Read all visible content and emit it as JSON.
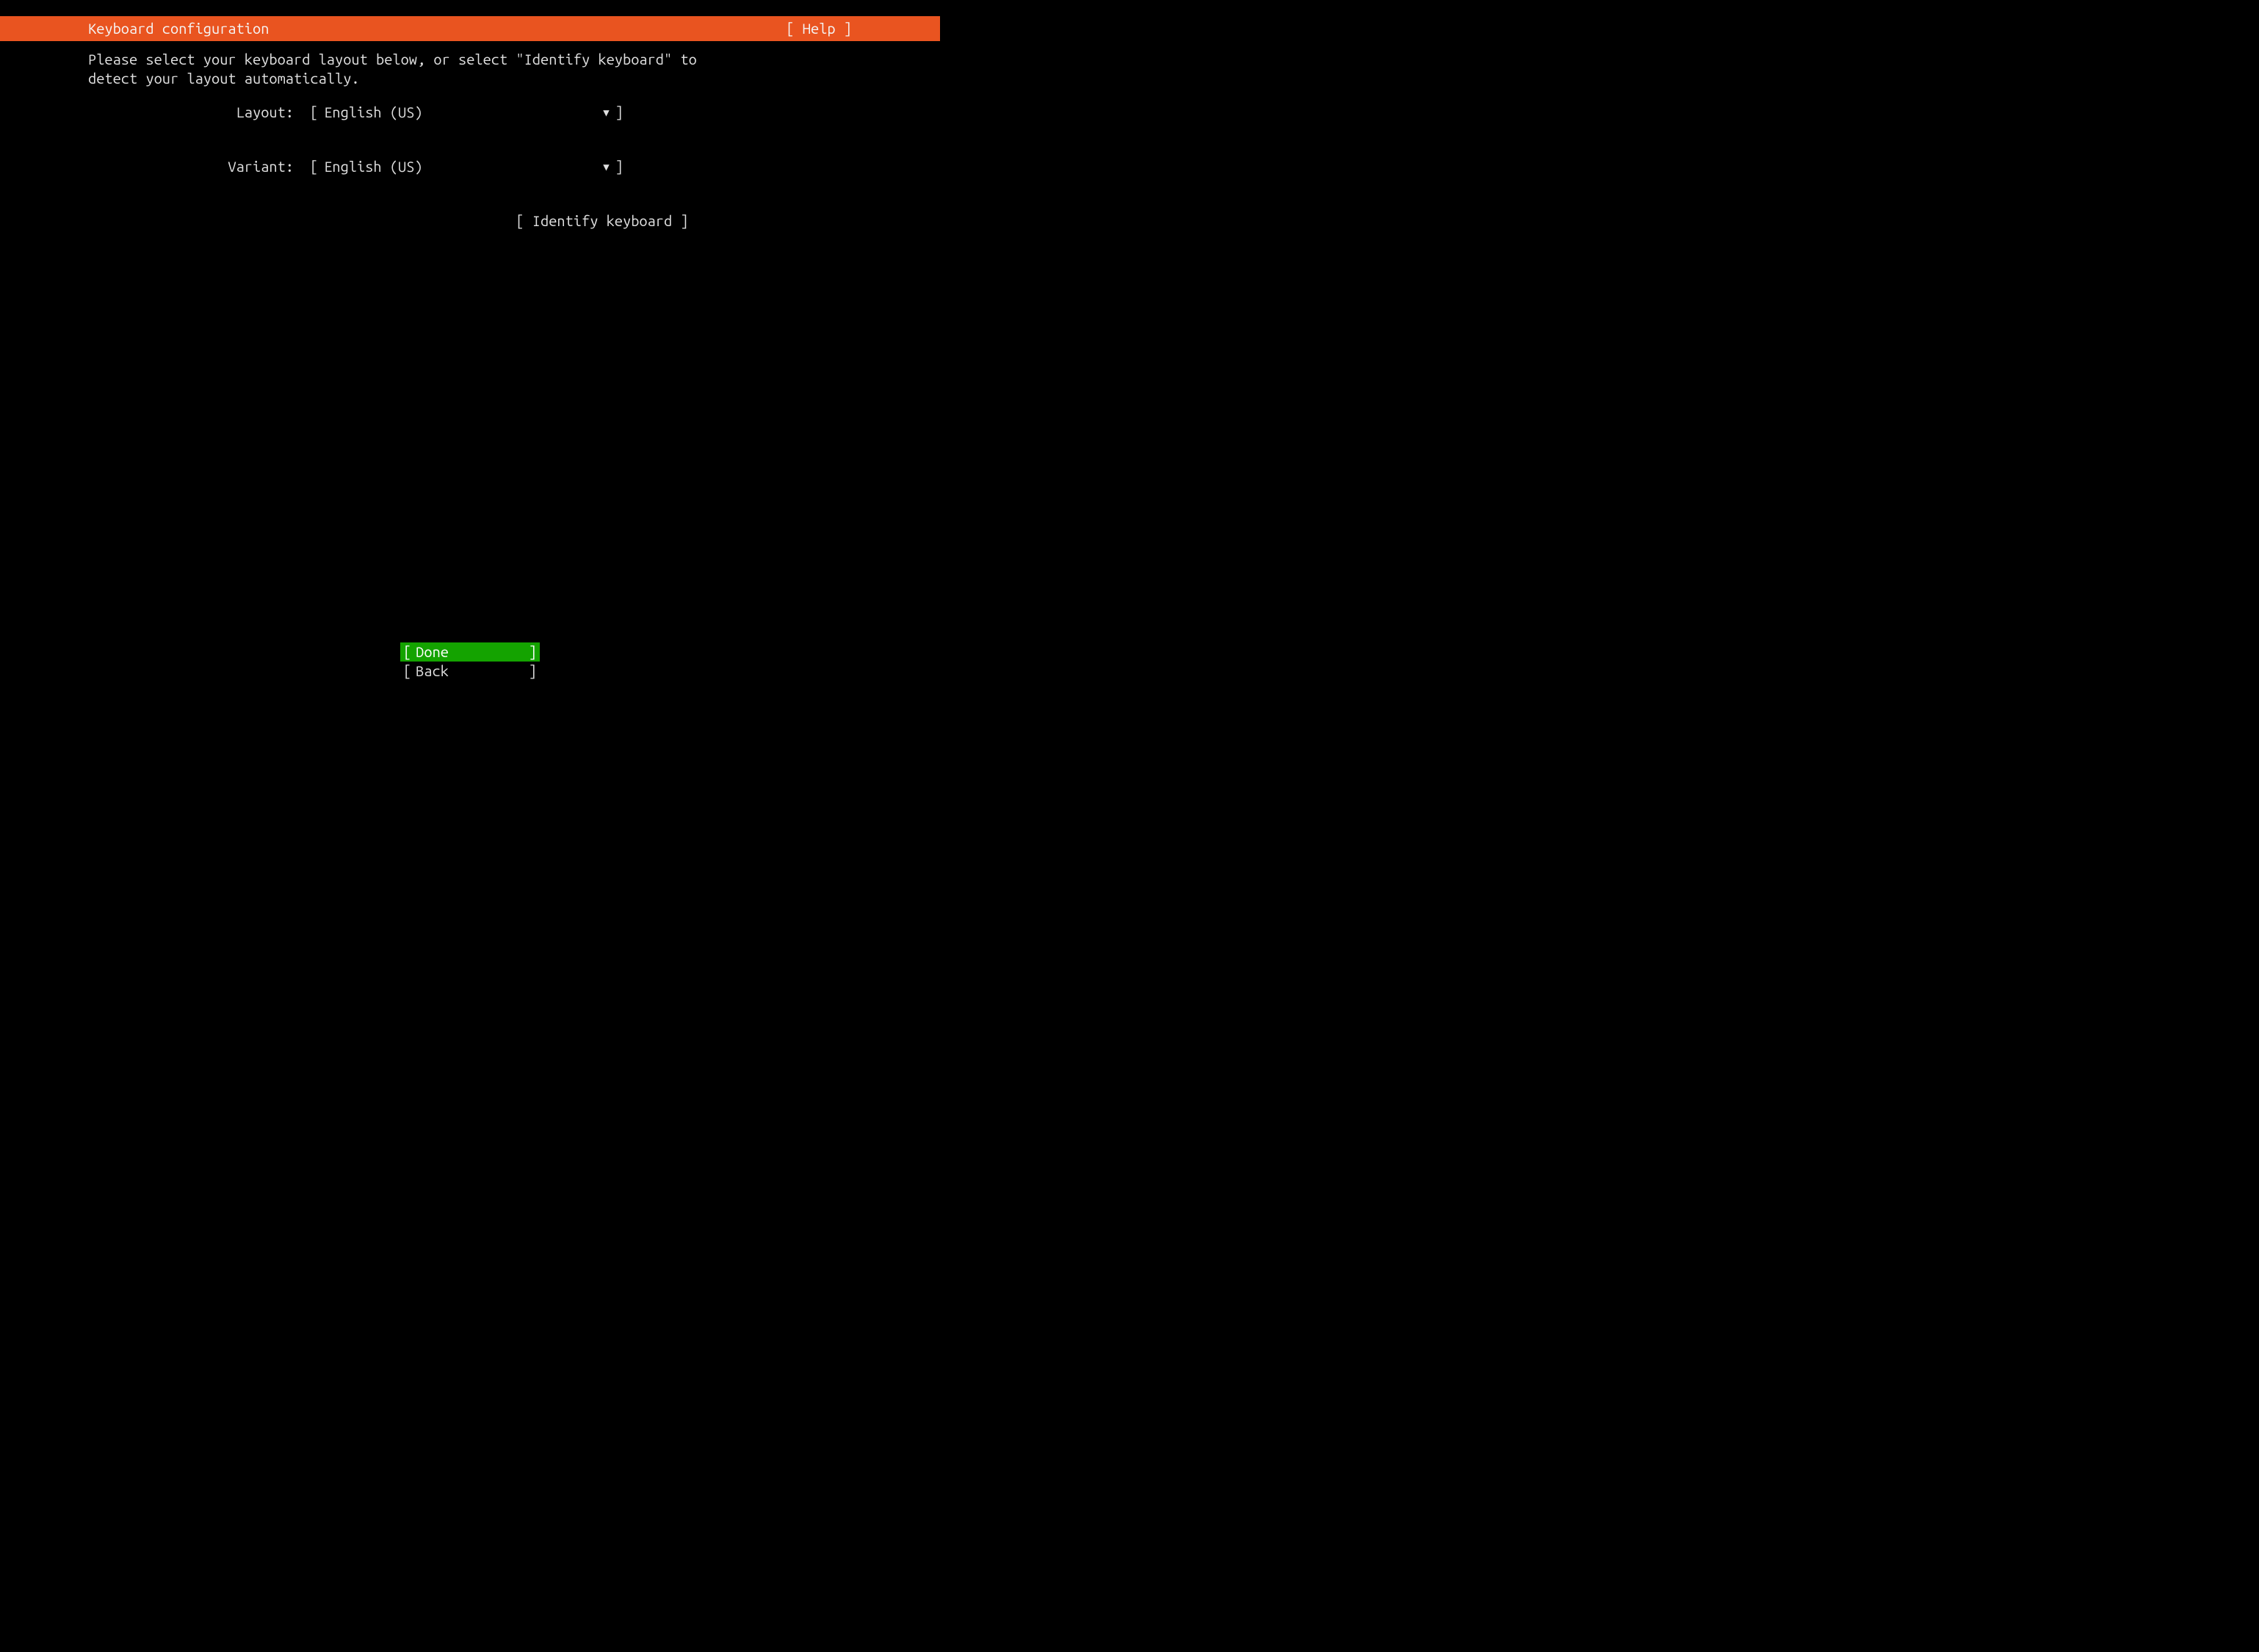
{
  "header": {
    "title": "Keyboard configuration",
    "help_label": "[ Help ]"
  },
  "instructions": "Please select your keyboard layout below, or select \"Identify keyboard\" to\ndetect your layout automatically.",
  "form": {
    "layout": {
      "label": "Layout:",
      "value": "English (US)"
    },
    "variant": {
      "label": "Variant:",
      "value": "English (US)"
    },
    "identify_label": "[ Identify keyboard ]"
  },
  "footer": {
    "done_label": "Done",
    "back_label": "Back"
  },
  "brackets": {
    "open": "[",
    "close": "]"
  },
  "icons": {
    "dropdown_arrow": "▼"
  }
}
